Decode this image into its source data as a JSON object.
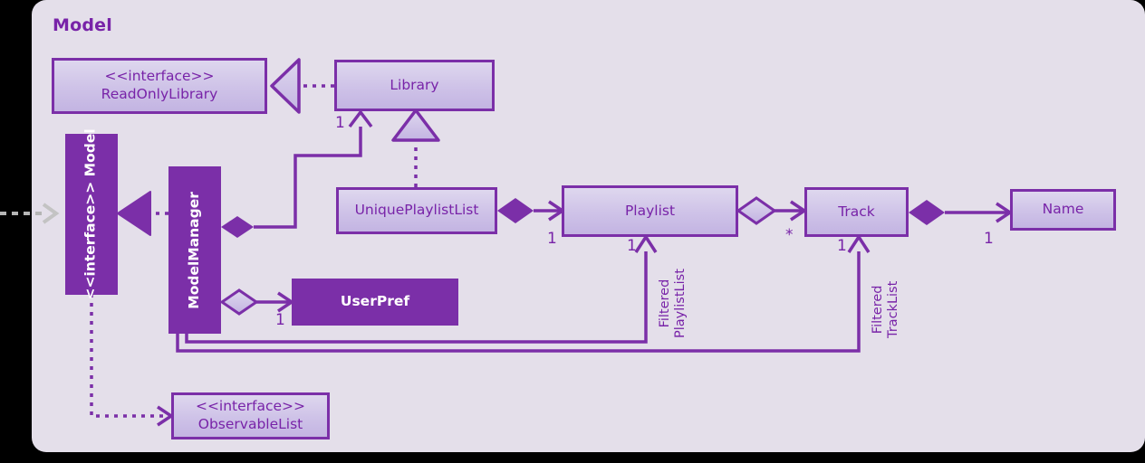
{
  "diagram": {
    "package_title": "Model",
    "type": "uml-class-diagram",
    "colors": {
      "panel_background": "#e4dfea",
      "outer_background": "#000000",
      "accent_purple": "#7b2fa8",
      "text_purple": "#7823a8",
      "solid_fill": "#7b2fa8",
      "light_fill_top": "#ded7ee",
      "light_fill_bottom": "#c3b4e2",
      "external_arrow_gray": "#b5b5b5"
    }
  },
  "classes": {
    "read_only_library": {
      "stereotype": "<<interface>>",
      "name": "ReadOnlyLibrary",
      "style": "light"
    },
    "library": {
      "name": "Library",
      "style": "light"
    },
    "model": {
      "stereotype": "<<interface>>",
      "name": "Model",
      "style": "solid",
      "orientation": "vertical"
    },
    "model_manager": {
      "name": "ModelManager",
      "style": "solid",
      "orientation": "vertical"
    },
    "unique_playlist_list": {
      "name": "UniquePlaylistList",
      "style": "light"
    },
    "playlist": {
      "name": "Playlist",
      "style": "light"
    },
    "track": {
      "name": "Track",
      "style": "light"
    },
    "name": {
      "name": "Name",
      "style": "light"
    },
    "user_pref": {
      "name": "UserPref",
      "style": "solid"
    },
    "observable_list": {
      "stereotype": "<<interface>>",
      "name": "ObservableList",
      "style": "light"
    }
  },
  "multiplicities": {
    "library_from_modelmanager": "1",
    "playlist_from_uniquelist": "1",
    "track_from_playlist": "*",
    "name_from_track": "1",
    "userpref_from_modelmanager": "1",
    "filtered_playlist_mult": "1",
    "filtered_track_mult": "1"
  },
  "edge_labels": {
    "filtered_playlist_list": "Filtered\nPlaylistList",
    "filtered_playlist_list_line1": "Filtered",
    "filtered_playlist_list_line2": "PlaylistList",
    "filtered_track_list_line1": "Filtered",
    "filtered_track_list_line2": "TrackList"
  },
  "relations": [
    {
      "from": "library",
      "to": "read_only_library",
      "type": "realization",
      "line": "dotted",
      "head": "hollow-triangle"
    },
    {
      "from": "unique_playlist_list",
      "to": "library",
      "type": "realization",
      "line": "dotted",
      "head": "hollow-triangle"
    },
    {
      "from": "model_manager",
      "to": "model",
      "type": "realization",
      "line": "dotted",
      "head": "solid-triangle"
    },
    {
      "from": "model_manager",
      "to": "library",
      "type": "composition",
      "line": "solid",
      "tail": "filled-diamond",
      "head": "open-arrow",
      "multiplicity": "1"
    },
    {
      "from": "model_manager",
      "to": "user_pref",
      "type": "aggregation",
      "line": "solid",
      "tail": "hollow-diamond",
      "head": "open-arrow",
      "multiplicity": "1"
    },
    {
      "from": "unique_playlist_list",
      "to": "playlist",
      "type": "composition",
      "line": "solid",
      "tail": "filled-diamond",
      "head": "open-arrow",
      "multiplicity": "1"
    },
    {
      "from": "playlist",
      "to": "track",
      "type": "aggregation",
      "line": "solid",
      "tail": "hollow-diamond",
      "head": "open-arrow",
      "multiplicity": "*"
    },
    {
      "from": "track",
      "to": "name",
      "type": "composition",
      "line": "solid",
      "tail": "filled-diamond",
      "head": "open-arrow",
      "multiplicity": "1"
    },
    {
      "from": "model_manager",
      "to": "playlist",
      "type": "association",
      "line": "solid",
      "head": "open-arrow",
      "label": "Filtered PlaylistList",
      "multiplicity": "1"
    },
    {
      "from": "model_manager",
      "to": "track",
      "type": "association",
      "line": "solid",
      "head": "open-arrow",
      "label": "Filtered TrackList",
      "multiplicity": "1"
    },
    {
      "from": "model",
      "to": "observable_list",
      "type": "dependency",
      "line": "dotted",
      "head": "open-arrow"
    },
    {
      "from": "external",
      "to": "model",
      "type": "dependency",
      "line": "dashed",
      "head": "open-arrow",
      "color": "gray"
    }
  ]
}
